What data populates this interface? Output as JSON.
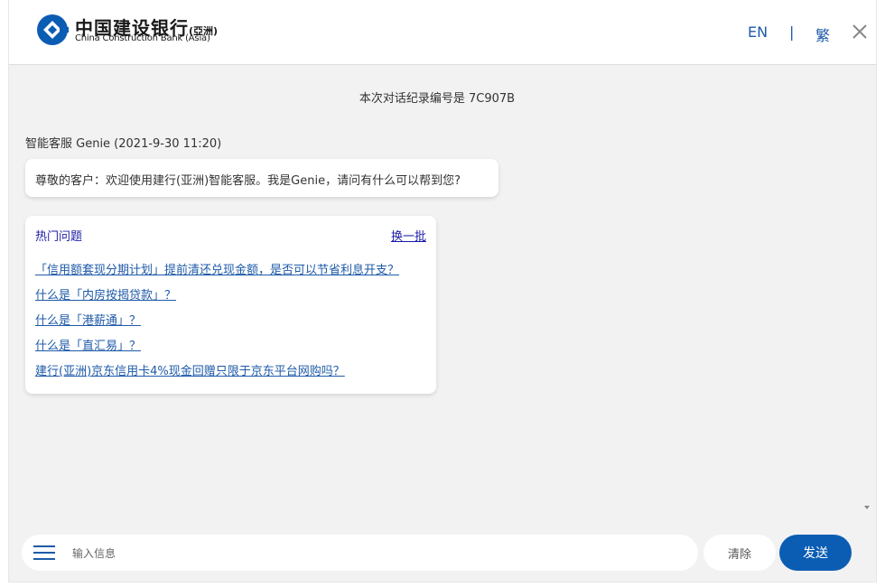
{
  "header": {
    "bank_name_zh": "中国建设银行",
    "bank_name_zh_suffix": "(亞洲)",
    "bank_name_en": "China Construction Bank (Asia)",
    "lang_en": "EN",
    "lang_sep": "|",
    "lang_tc": "繁",
    "brand_color": "#1e5aa8"
  },
  "chat": {
    "record_line": "本次对话纪录编号是 7C907B",
    "sender": "智能客服 Genie (2021-9-30 11:20)",
    "greeting": "尊敬的客户：欢迎使用建行(亚洲)智能客服。我是Genie，请问有什么可以帮到您?",
    "hot_title": "热门问题",
    "hot_refresh": "换一批",
    "questions": [
      "「信用额套现分期计划」提前清还兑现金额，是否可以节省利息开支？",
      "什么是「内房按揭贷款」？",
      "什么是「港薪通」？",
      "什么是「直汇易」？",
      "建行(亚洲)京东信用卡4%现金回赠只限于京东平台网购吗？"
    ]
  },
  "composer": {
    "placeholder": "输入信息",
    "value": "",
    "clear_label": "清除",
    "send_label": "发送",
    "send_color": "#0b5db3"
  }
}
